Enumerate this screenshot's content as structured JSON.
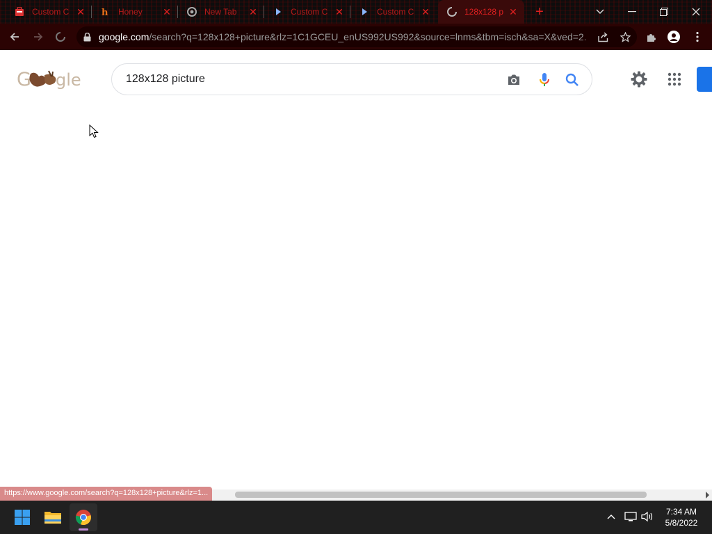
{
  "tabs": [
    {
      "title": "Custom C",
      "icon": "bag-icon"
    },
    {
      "title": "Honey",
      "icon": "honey-icon"
    },
    {
      "title": "New Tab",
      "icon": "chrome-icon"
    },
    {
      "title": "Custom C",
      "icon": "play-icon"
    },
    {
      "title": "Custom C",
      "icon": "play-icon"
    },
    {
      "title": "128x128 p",
      "icon": "loading-icon",
      "active": true
    }
  ],
  "omnibox": {
    "domain": "google.com",
    "path": "/search?q=128x128+picture&rlz=1C1GCEU_enUS992US992&source=lnms&tbm=isch&sa=X&ved=2..."
  },
  "search": {
    "query": "128x128 picture"
  },
  "status_url": "https://www.google.com/search?q=128x128+picture&rlz=1...",
  "clock": {
    "time": "7:34 AM",
    "date": "5/8/2022"
  },
  "colors": {
    "accent": "#e02020",
    "tab_bg": "#0d0d0d",
    "toolbar_bg": "#2b0303",
    "google_blue": "#1a73e8"
  }
}
